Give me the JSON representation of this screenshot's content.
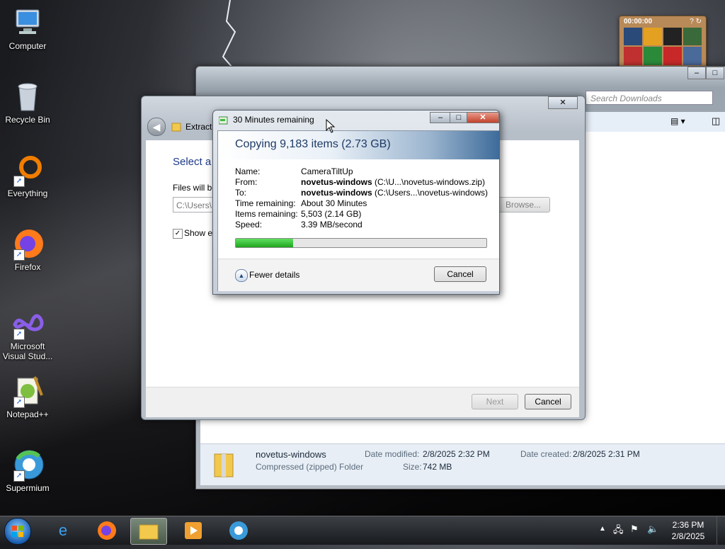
{
  "desktop": {
    "icons": [
      {
        "label": "Computer"
      },
      {
        "label": "Recycle Bin"
      },
      {
        "label": "Everything"
      },
      {
        "label": "Firefox"
      },
      {
        "label": "Microsoft Visual Stud..."
      },
      {
        "label": "Notepad++"
      },
      {
        "label": "Supermium"
      }
    ]
  },
  "gadget": {
    "timer": "00:00:00"
  },
  "explorer": {
    "search_placeholder": "Search Downloads",
    "file": {
      "name": "novetus-windows",
      "type": "Compressed (zipped) Folder",
      "date_modified_label": "Date modified:",
      "date_modified": "2/8/2025 2:32 PM",
      "size_label": "Size:",
      "size": "742 MB",
      "date_created_label": "Date created:",
      "date_created": "2/8/2025 2:31 PM"
    }
  },
  "extract": {
    "title": "Extract",
    "heading": "Select a",
    "files_label": "Files will be",
    "path_value": "C:\\Users\\",
    "browse_label": "Browse...",
    "show_label": "Show e",
    "next_label": "Next",
    "cancel_label": "Cancel"
  },
  "copy": {
    "title": "30 Minutes remaining",
    "heading": "Copying 9,183 items (2.73 GB)",
    "name_label": "Name:",
    "name_value": "CameraTiltUp",
    "from_label": "From:",
    "from_bold": "novetus-windows",
    "from_path": " (C:\\U...\\novetus-windows.zip)",
    "to_label": "To:",
    "to_bold": "novetus-windows",
    "to_path": " (C:\\Users...\\novetus-windows)",
    "time_label": "Time remaining:",
    "time_value": "About 30 Minutes",
    "items_label": "Items remaining:",
    "items_value": "5,503 (2.14 GB)",
    "speed_label": "Speed:",
    "speed_value": "3.39 MB/second",
    "progress_fraction": 0.23,
    "fewer_details": "Fewer details",
    "cancel_label": "Cancel"
  },
  "taskbar": {
    "time": "2:36 PM",
    "date": "2/8/2025"
  }
}
